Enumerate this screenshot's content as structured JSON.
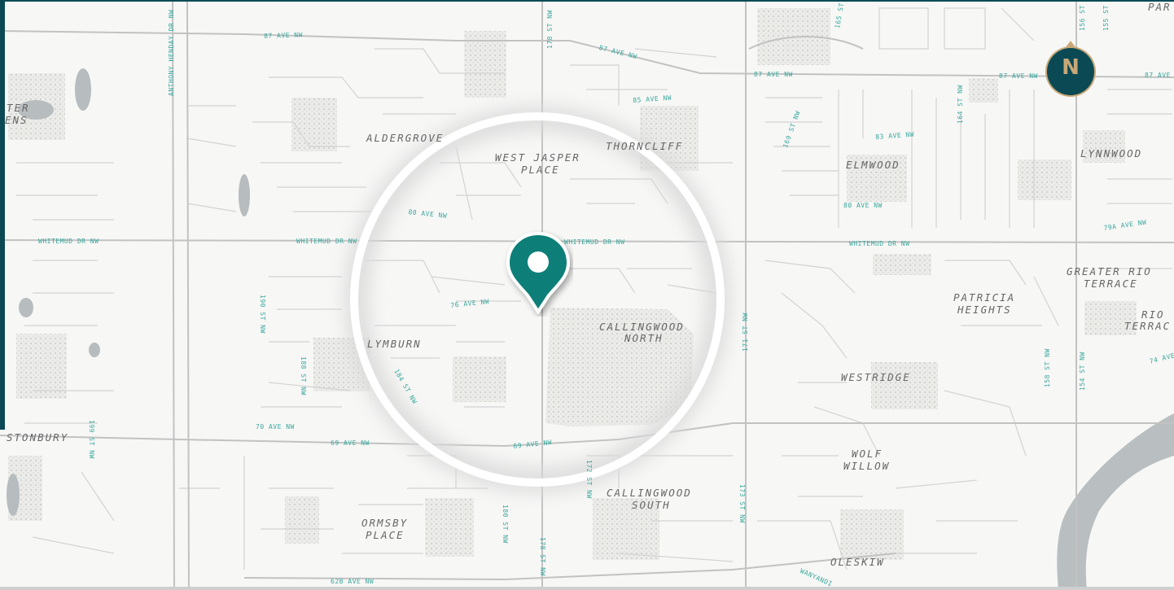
{
  "neighbourhoods": {
    "aldergrove": "ALDERGROVE",
    "west_jasper_place_1": "WEST JASPER",
    "west_jasper_place_2": "PLACE",
    "thorncliff": "THORNCLIFF",
    "elmwood": "ELMWOOD",
    "lynnwood": "LYNNWOOD",
    "greater_rio_1": "GREATER RIO",
    "greater_rio_2": "TERRACE",
    "rio_1": "RIO",
    "rio_2": "TERRAC",
    "patricia_1": "PATRICIA",
    "patricia_2": "HEIGHTS",
    "lymburn": "LYMBURN",
    "callingwood_north_1": "CALLINGWOOD",
    "callingwood_north_2": "NORTH",
    "westridge": "WESTRIDGE",
    "wolf_willow_1": "WOLF",
    "wolf_willow_2": "WILLOW",
    "callingwood_south_1": "CALLINGWOOD",
    "callingwood_south_2": "SOUTH",
    "ormsby_1": "ORMSBY",
    "ormsby_2": "PLACE",
    "oleskiw": "OLESKIW",
    "stonbury": "STONBURY",
    "partial_ter": "TER",
    "partial_ens": "ENS",
    "partial_par": "PAR"
  },
  "streets": {
    "ave87_a": "87 AVE NW",
    "ave87_b": "87 AVE NW",
    "ave87_c": "87 AVE NW",
    "ave87_d": "87 AVE NW",
    "ave87_e": "87 AVE NW",
    "ave85": "85 AVE NW",
    "ave83": "83 AVE NW",
    "ave80_a": "80 AVE NW",
    "ave80_b": "80 AVE NW",
    "ave79a": "79A AVE NW",
    "whitemud_a": "WHITEMUD DR NW",
    "whitemud_b": "WHITEMUD DR NW",
    "whitemud_c": "WHITEMUD DR NW",
    "whitemud_d": "WHITEMUD DR NW",
    "ave76": "76 AVE NW",
    "ave74": "74 AVE NW",
    "ave70": "70 AVE NW",
    "ave69_a": "69 AVE NW",
    "ave69_b": "69 AVE NW",
    "ave62b": "62B AVE NW",
    "wanyandi": "WANYANDI",
    "henday": "ANTHONY HENDAY DR NW",
    "st178_a": "178 ST NW",
    "st178_b": "178 ST NW",
    "st169": "169 ST NW",
    "st165": "165 ST NW",
    "st164": "164 ST NW",
    "st156": "156 ST NW",
    "st155": "155 ST NW",
    "st158": "158 ST NW",
    "st154": "154 ST NW",
    "st171": "171 ST NW",
    "st173": "173 ST NW",
    "st172": "172 ST NW",
    "st180": "180 ST NW",
    "st184": "184 ST NW",
    "st190": "190 ST NW",
    "st188": "188 ST NW",
    "st199": "199 ST NW"
  },
  "compass": {
    "letter": "N"
  },
  "colors": {
    "accent": "#0b4a55",
    "pin": "#0e7f78",
    "street_label": "#3aa89c",
    "compass_letter": "#c9a878",
    "river": "#b9bfc0"
  },
  "icons": {
    "pin": "location-pin-icon",
    "compass": "north-compass-icon"
  }
}
